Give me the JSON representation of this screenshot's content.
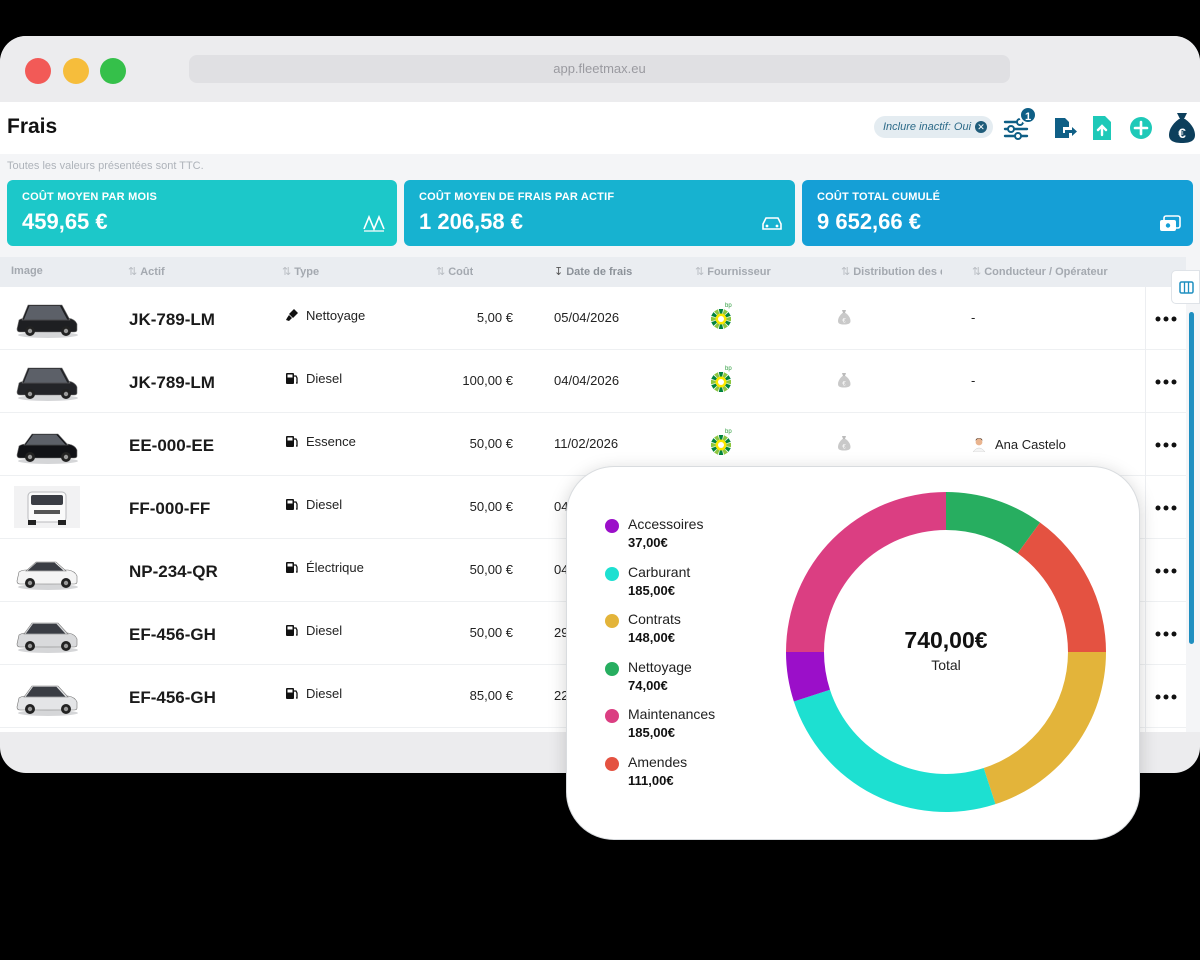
{
  "browser": {
    "url": "app.fleetmax.eu"
  },
  "header": {
    "title": "Frais",
    "filter_chip": "Inclure inactif: Oui",
    "filter_count": "1"
  },
  "note": "Toutes les valeurs présentées sont TTC.",
  "kpis": [
    {
      "label": "COÛT MOYEN PAR MOIS",
      "value": "459,65 €",
      "icon": "chart-icon",
      "color": "#1cc8c9"
    },
    {
      "label": "COÛT MOYEN DE FRAIS PAR ACTIF",
      "value": "1 206,58 €",
      "icon": "car-icon",
      "color": "#17b2d0"
    },
    {
      "label": "COÛT TOTAL CUMULÉ",
      "value": "9 652,66 €",
      "icon": "money-icon",
      "color": "#159fd6"
    }
  ],
  "table": {
    "columns": [
      "Image",
      "Actif",
      "Type",
      "Coût",
      "Date de frais",
      "Fournisseur",
      "Distribution des c",
      "Conducteur / Opérateur"
    ],
    "rows": [
      {
        "plate": "JK-789-LM",
        "type": "Nettoyage",
        "type_icon": "brush-icon",
        "cost": "5,00 €",
        "date": "05/04/2026",
        "driver": "-"
      },
      {
        "plate": "JK-789-LM",
        "type": "Diesel",
        "type_icon": "fuel-icon",
        "cost": "100,00 €",
        "date": "04/04/2026",
        "driver": "-"
      },
      {
        "plate": "EE-000-EE",
        "type": "Essence",
        "type_icon": "fuel-icon",
        "cost": "50,00 €",
        "date": "11/02/2026",
        "driver": "Ana Castelo"
      },
      {
        "plate": "FF-000-FF",
        "type": "Diesel",
        "type_icon": "fuel-icon",
        "cost": "50,00 €",
        "date": "04",
        "driver": ""
      },
      {
        "plate": "NP-234-QR",
        "type": "Électrique",
        "type_icon": "fuel-icon",
        "cost": "50,00 €",
        "date": "04",
        "driver": ""
      },
      {
        "plate": "EF-456-GH",
        "type": "Diesel",
        "type_icon": "fuel-icon",
        "cost": "50,00 €",
        "date": "29",
        "driver": ""
      },
      {
        "plate": "EF-456-GH",
        "type": "Diesel",
        "type_icon": "fuel-icon",
        "cost": "85,00 €",
        "date": "22",
        "driver": ""
      }
    ]
  },
  "breakdown": {
    "total": "740,00€",
    "total_label": "Total",
    "items": [
      {
        "name": "Accessoires",
        "value": "37,00€",
        "amount": 37,
        "color": "#9b0fc9"
      },
      {
        "name": "Carburant",
        "value": "185,00€",
        "amount": 185,
        "color": "#1de0d1"
      },
      {
        "name": "Contrats",
        "value": "148,00€",
        "amount": 148,
        "color": "#e3b43a"
      },
      {
        "name": "Nettoyage",
        "value": "74,00€",
        "amount": 74,
        "color": "#27ae60"
      },
      {
        "name": "Maintenances",
        "value": "185,00€",
        "amount": 185,
        "color": "#db3e82"
      },
      {
        "name": "Amendes",
        "value": "111,00€",
        "amount": 111,
        "color": "#e45241"
      }
    ],
    "draw_order": [
      "Nettoyage",
      "Amendes",
      "Contrats",
      "Carburant",
      "Accessoires",
      "Maintenances"
    ]
  }
}
